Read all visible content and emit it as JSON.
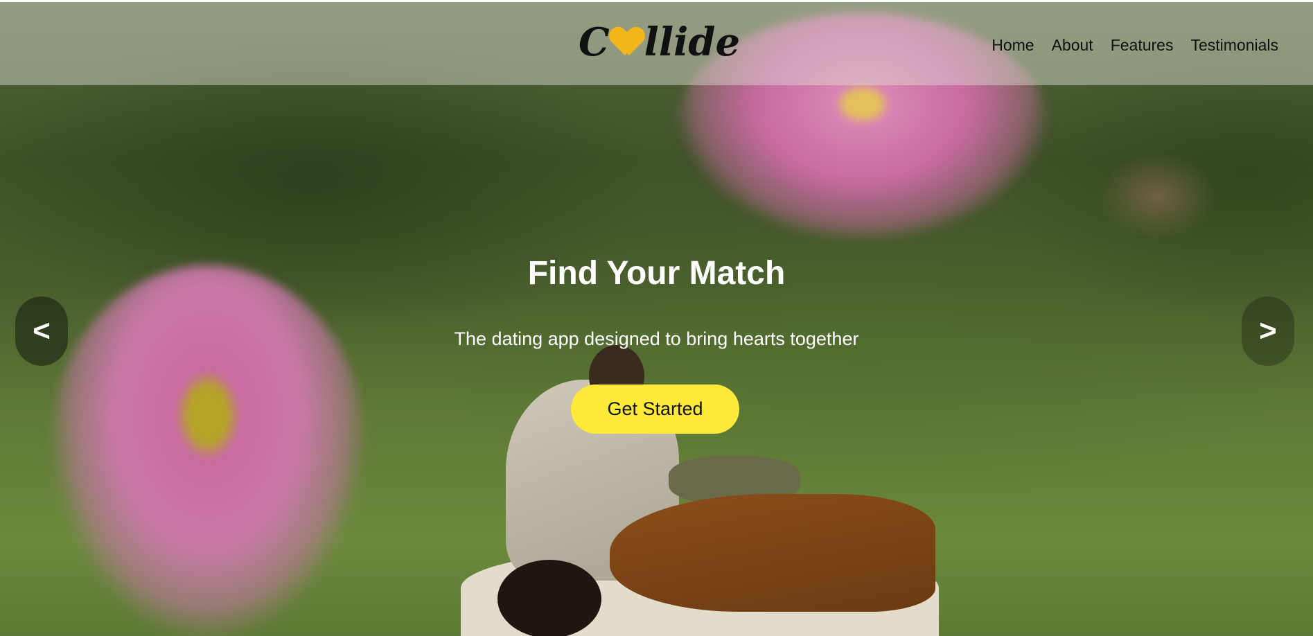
{
  "brand": {
    "logo_prefix": "C",
    "logo_suffix": "llide",
    "logo_icon": "heart-icon",
    "accent_color": "#ffe93b",
    "heart_color": "#f2b71c"
  },
  "nav": {
    "items": [
      "Home",
      "About",
      "Features",
      "Testimonials"
    ]
  },
  "hero": {
    "title": "Find Your Match",
    "subtitle": "The dating app designed to bring hearts together",
    "cta_label": "Get Started",
    "prev_label": "<",
    "next_label": ">"
  }
}
